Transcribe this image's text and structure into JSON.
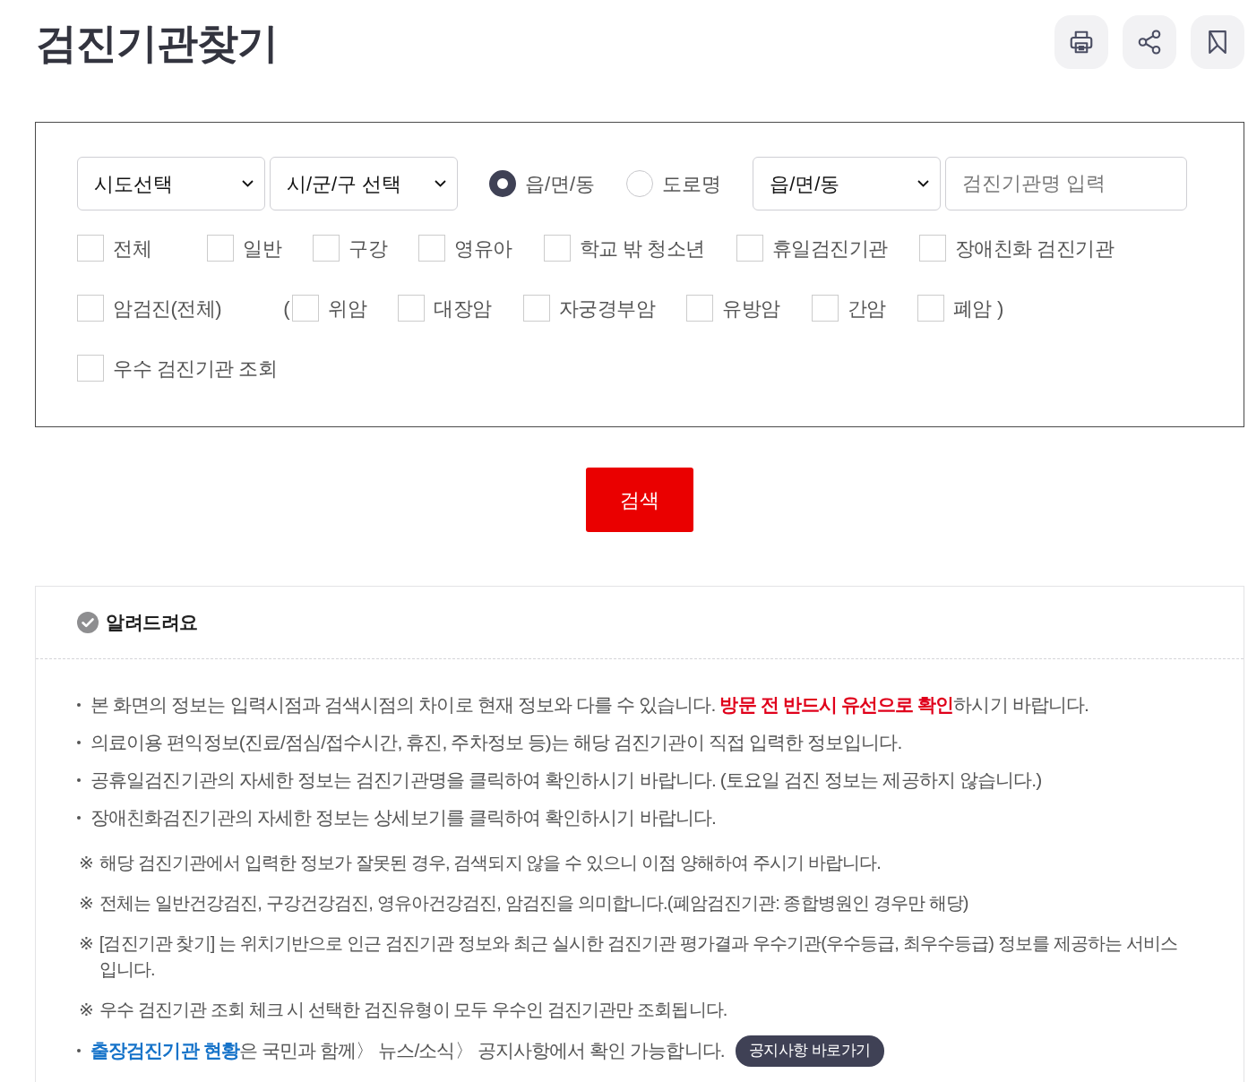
{
  "page": {
    "title": "검진기관찾기"
  },
  "toolbar": [
    {
      "kind": "print"
    },
    {
      "kind": "share"
    },
    {
      "kind": "bookmark"
    }
  ],
  "search_form": {
    "selects": [
      {
        "value": "시도선택"
      },
      {
        "value": "시/군/구 선택"
      }
    ],
    "address_type": [
      {
        "label": "읍/면/동",
        "selected": true
      },
      {
        "label": "도로명",
        "selected": false
      }
    ],
    "district_select": {
      "value": "읍/면/동"
    },
    "name_field": {
      "placeholder": "검진기관명 입력"
    },
    "option_rows": [
      [
        {
          "kind": "checkbox",
          "label": "전체",
          "checked": false
        },
        {
          "kind": "checkbox",
          "label": "일반",
          "checked": false
        },
        {
          "kind": "checkbox",
          "label": "구강",
          "checked": false
        },
        {
          "kind": "checkbox",
          "label": "영유아",
          "checked": false
        },
        {
          "kind": "checkbox",
          "label": "학교 밖 청소년",
          "checked": false
        },
        {
          "kind": "checkbox",
          "label": "휴일검진기관",
          "checked": false
        },
        {
          "kind": "checkbox",
          "label": "장애친화 검진기관",
          "checked": false
        }
      ],
      [
        {
          "kind": "checkbox",
          "label": "암검진(전체)",
          "checked": false
        },
        {
          "kind": "text",
          "text": "("
        },
        {
          "kind": "checkbox",
          "label": "위암",
          "checked": false
        },
        {
          "kind": "checkbox",
          "label": "대장암",
          "checked": false
        },
        {
          "kind": "checkbox",
          "label": "자궁경부암",
          "checked": false
        },
        {
          "kind": "checkbox",
          "label": "유방암",
          "checked": false
        },
        {
          "kind": "checkbox",
          "label": "간암",
          "checked": false
        },
        {
          "kind": "checkbox",
          "label": "폐암",
          "checked": false
        },
        {
          "kind": "text",
          "text": ")"
        }
      ],
      [
        {
          "kind": "checkbox",
          "label": "우수 검진기관 조회",
          "checked": false
        }
      ]
    ]
  },
  "search_button": {
    "label": "검색"
  },
  "notice": {
    "title": "알려드려요",
    "items": [
      {
        "kind": "bullet",
        "text": "본 화면의 정보는 입력시점과 검색시점의 차이로 현재 정보와 다를 수 있습니다. **방문 전 반드시 유선으로 확인**하시기 바랍니다."
      },
      {
        "kind": "bullet",
        "text": "의료이용 편익정보(진료/점심/접수시간, 휴진, 주차정보 등)는 해당 검진기관이 직접 입력한 정보입니다."
      },
      {
        "kind": "bullet",
        "text": "공휴일검진기관의 자세한 정보는 검진기관명을 클릭하여 확인하시기 바랍니다. (토요일 검진 정보는 제공하지 않습니다.)"
      },
      {
        "kind": "bullet",
        "text": "장애친화검진기관의 자세한 정보는 상세보기를 클릭하여 확인하시기 바랍니다."
      },
      {
        "kind": "note",
        "marker": "※",
        "text": "해당 검진기관에서 입력한 정보가 잘못된 경우, 검색되지 않을 수 있으니 이점 양해하여 주시기 바랍니다."
      },
      {
        "kind": "note",
        "marker": "※",
        "text": "전체는 일반건강검진, 구강건강검진, 영유아건강검진, 암검진을 의미합니다.(폐암검진기관: 종합병원인 경우만 해당)"
      },
      {
        "kind": "note",
        "marker": "※",
        "text": "[검진기관 찾기] 는 위치기반으로 인근 검진기관 정보와 최근 실시한 검진기관 평가결과 우수기관(우수등급, 최우수등급) 정보를 제공하는 서비스입니다."
      },
      {
        "kind": "note",
        "marker": "※",
        "text": "우수 검진기관 조회 체크 시 선택한 검진유형이 모두 우수인 검진기관만 조회됩니다."
      },
      {
        "kind": "bullet",
        "link": "출장검진기관 현황",
        "text": "은 국민과 함께〉 뉴스/소식〉 공지사항에서 확인 가능합니다.",
        "button": "공지사항 바로가기"
      }
    ]
  }
}
